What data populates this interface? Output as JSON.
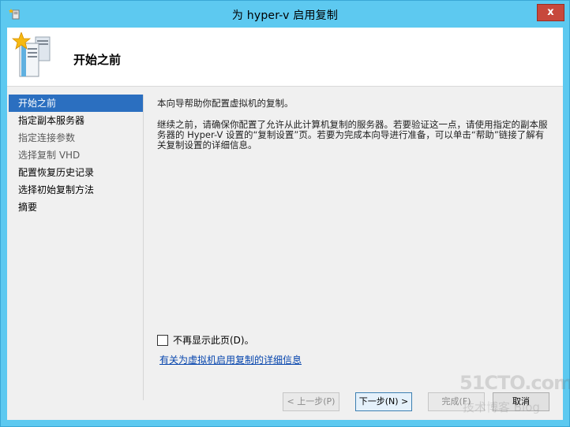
{
  "window": {
    "title": "为 hyper-v 启用复制",
    "close_label": "x",
    "accent_color": "#5dc9f0"
  },
  "header": {
    "title": "开始之前",
    "icon": "server-star-icon"
  },
  "nav": {
    "items": [
      {
        "label": "开始之前",
        "selected": true
      },
      {
        "label": "指定副本服务器",
        "selected": false
      },
      {
        "label": "指定连接参数",
        "selected": false
      },
      {
        "label": "选择复制 VHD",
        "selected": false
      },
      {
        "label": "配置恢复历史记录",
        "selected": false
      },
      {
        "label": "选择初始复制方法",
        "selected": false
      },
      {
        "label": "摘要",
        "selected": false
      }
    ]
  },
  "content": {
    "intro": "本向导帮助你配置虚拟机的复制。",
    "body": "继续之前，请确保你配置了允许从此计算机复制的服务器。若要验证这一点，请使用指定的副本服务器的 Hyper-V 设置的“复制设置”页。若要为完成本向导进行准备，可以单击“帮助”链接了解有关复制设置的详细信息。",
    "dont_show_label": "不再显示此页(D)。",
    "dont_show_checked": false,
    "help_link": "有关为虚拟机启用复制的详细信息"
  },
  "footer": {
    "prev_label": "< 上一步(P)",
    "next_label": "下一步(N) >",
    "finish_label": "完成(F)",
    "cancel_label": "取消"
  },
  "watermark": {
    "line1": "51CTO.com",
    "line2": "技术博客 Blog"
  }
}
